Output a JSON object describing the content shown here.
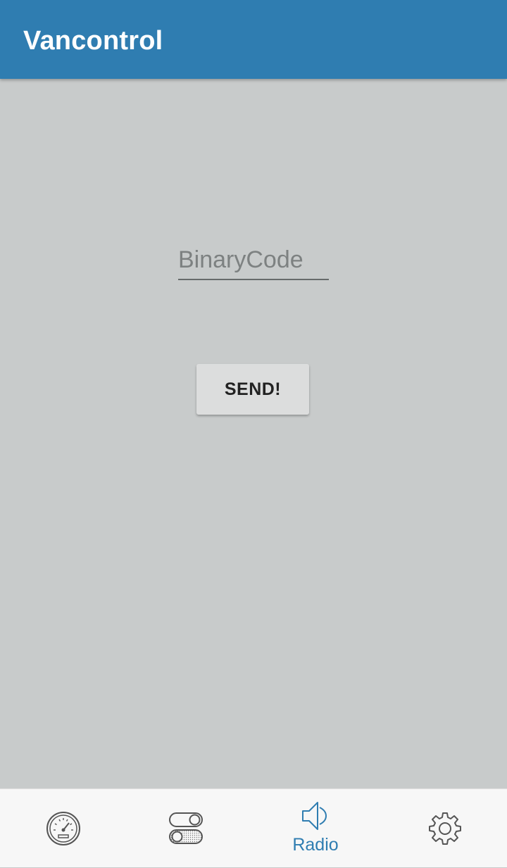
{
  "app": {
    "title": "Vancontrol"
  },
  "form": {
    "binary_code_placeholder": "BinaryCode",
    "binary_code_value": "",
    "send_label": "SEND!"
  },
  "bottom_nav": {
    "items": [
      {
        "id": "dashboard",
        "icon": "speedometer-icon",
        "label": ""
      },
      {
        "id": "switches",
        "icon": "toggle-switches-icon",
        "label": ""
      },
      {
        "id": "radio",
        "icon": "speaker-icon",
        "label": "Radio",
        "active": true
      },
      {
        "id": "settings",
        "icon": "gear-icon",
        "label": ""
      }
    ]
  },
  "colors": {
    "primary": "#2f7db1",
    "background": "#c8cbcb",
    "nav_background": "#f7f7f7",
    "inactive_icon": "#555555"
  }
}
